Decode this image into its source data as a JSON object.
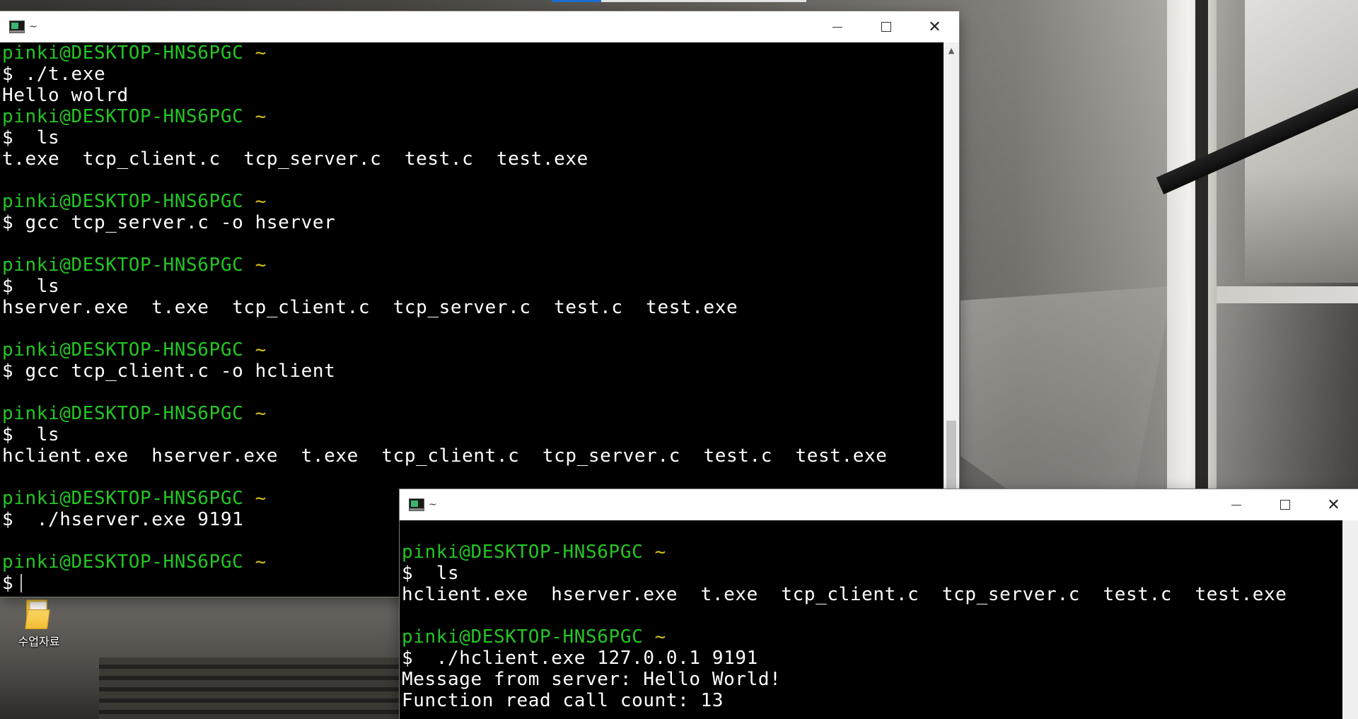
{
  "desktop": {
    "icons": [
      {
        "label": "수업자료"
      }
    ]
  },
  "windows": [
    {
      "title": "~",
      "controls": {
        "minimize": "—",
        "maximize": "☐",
        "close": "✕"
      },
      "lines": [
        {
          "kind": "prompt",
          "user": "pinki@DESKTOP-HNS6PGC",
          "path": "~"
        },
        {
          "kind": "cmd",
          "text": "$ ./t.exe"
        },
        {
          "kind": "out",
          "text": "Hello wolrd"
        },
        {
          "kind": "prompt",
          "user": "pinki@DESKTOP-HNS6PGC",
          "path": "~"
        },
        {
          "kind": "cmd",
          "text": "$  ls"
        },
        {
          "kind": "out",
          "text": "t.exe  tcp_client.c  tcp_server.c  test.c  test.exe"
        },
        {
          "kind": "out",
          "text": ""
        },
        {
          "kind": "prompt",
          "user": "pinki@DESKTOP-HNS6PGC",
          "path": "~"
        },
        {
          "kind": "cmd",
          "text": "$ gcc tcp_server.c -o hserver"
        },
        {
          "kind": "out",
          "text": ""
        },
        {
          "kind": "prompt",
          "user": "pinki@DESKTOP-HNS6PGC",
          "path": "~"
        },
        {
          "kind": "cmd",
          "text": "$  ls"
        },
        {
          "kind": "out",
          "text": "hserver.exe  t.exe  tcp_client.c  tcp_server.c  test.c  test.exe"
        },
        {
          "kind": "out",
          "text": ""
        },
        {
          "kind": "prompt",
          "user": "pinki@DESKTOP-HNS6PGC",
          "path": "~"
        },
        {
          "kind": "cmd",
          "text": "$ gcc tcp_client.c -o hclient"
        },
        {
          "kind": "out",
          "text": ""
        },
        {
          "kind": "prompt",
          "user": "pinki@DESKTOP-HNS6PGC",
          "path": "~"
        },
        {
          "kind": "cmd",
          "text": "$  ls"
        },
        {
          "kind": "out",
          "text": "hclient.exe  hserver.exe  t.exe  tcp_client.c  tcp_server.c  test.c  test.exe"
        },
        {
          "kind": "out",
          "text": ""
        },
        {
          "kind": "prompt",
          "user": "pinki@DESKTOP-HNS6PGC",
          "path": "~"
        },
        {
          "kind": "cmd",
          "text": "$  ./hserver.exe 9191"
        },
        {
          "kind": "out",
          "text": ""
        },
        {
          "kind": "prompt",
          "user": "pinki@DESKTOP-HNS6PGC",
          "path": "~"
        },
        {
          "kind": "input",
          "text": "$"
        }
      ]
    },
    {
      "title": "~",
      "controls": {
        "minimize": "—",
        "maximize": "☐",
        "close": "✕"
      },
      "lines": [
        {
          "kind": "out",
          "text": ""
        },
        {
          "kind": "prompt",
          "user": "pinki@DESKTOP-HNS6PGC",
          "path": "~"
        },
        {
          "kind": "cmd",
          "text": "$  ls"
        },
        {
          "kind": "out",
          "text": "hclient.exe  hserver.exe  t.exe  tcp_client.c  tcp_server.c  test.c  test.exe"
        },
        {
          "kind": "out",
          "text": ""
        },
        {
          "kind": "prompt",
          "user": "pinki@DESKTOP-HNS6PGC",
          "path": "~"
        },
        {
          "kind": "cmd",
          "text": "$  ./hclient.exe 127.0.0.1 9191"
        },
        {
          "kind": "out",
          "text": "Message from server: Hello World!"
        },
        {
          "kind": "out",
          "text": "Function read call count: 13"
        }
      ]
    }
  ]
}
